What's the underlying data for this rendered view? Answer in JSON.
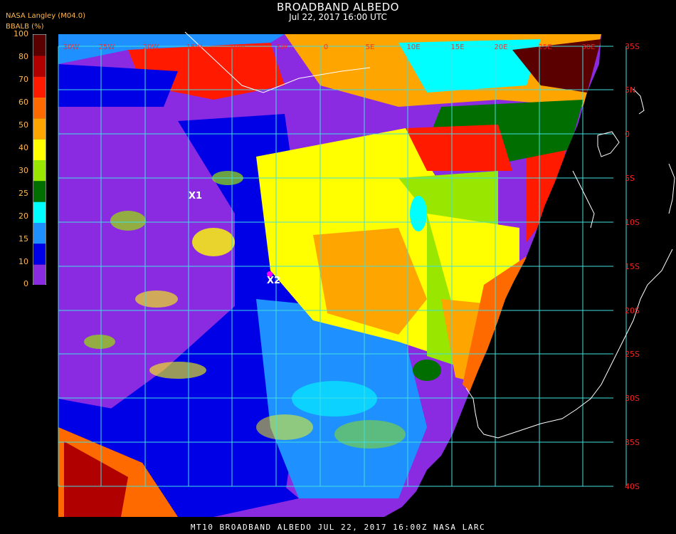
{
  "header": {
    "title": "BROADBAND ALBEDO",
    "datetime": "Jul 22, 2017 16:00 UTC",
    "org": "NASA Langley (M04.0)",
    "product": "BBALB (%)"
  },
  "legend": {
    "ticks": [
      "100",
      "80",
      "70",
      "60",
      "50",
      "40",
      "30",
      "25",
      "20",
      "15",
      "10",
      "0"
    ],
    "colors": [
      "#5a0000",
      "#b00000",
      "#ff1a00",
      "#ff6a00",
      "#ffa500",
      "#ffff00",
      "#99e600",
      "#006e00",
      "#00ffff",
      "#1e90ff",
      "#0000e6",
      "#8a2be2"
    ]
  },
  "grid": {
    "lat_labels": [
      "35S",
      "5N",
      "0",
      "5S",
      "10S",
      "15S",
      "20S",
      "25S",
      "30S",
      "35S",
      "40S"
    ],
    "lon_labels": [
      "30E",
      "25E",
      "20E",
      "15E",
      "10E",
      "5E",
      "0",
      "5W",
      "10W",
      "15W",
      "20W",
      "25W",
      "30W"
    ]
  },
  "markers": [
    {
      "id": "x1",
      "label": "X1"
    },
    {
      "id": "x2",
      "label": "X2"
    }
  ],
  "footer": "MT10  BROADBAND ALBEDO   JUL 22, 2017 16:00Z   NASA LARC"
}
